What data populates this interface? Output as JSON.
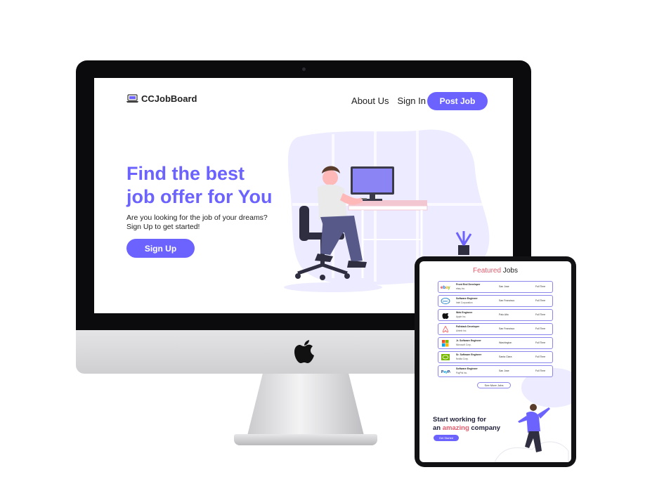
{
  "colors": {
    "accent": "#6c63ff",
    "accent_pink": "#e25a6b",
    "text": "#1e1e1e",
    "bezel": "#0b0b0d",
    "blob": "#ecebff"
  },
  "desktop": {
    "nav": {
      "logo_text": "CCJobBoard",
      "logo_icon": "laptop-icon",
      "links": [
        "About Us",
        "Sign In"
      ],
      "post_job_label": "Post Job"
    },
    "hero": {
      "title_line1": "Find the best",
      "title_line2": "job offer for You",
      "subtitle_line1": "Are you looking for the job of your dreams?",
      "subtitle_line2": "Sign Up to get started!",
      "signup_label": "Sign Up"
    }
  },
  "tablet": {
    "featured_title_accent": "Featured",
    "featured_title_rest": " Jobs",
    "jobs": [
      {
        "title": "Front End Developer",
        "company": "ebay Inc.",
        "location": "San Jose",
        "type": "Full Time",
        "logo": "ebay-logo"
      },
      {
        "title": "Software Engineer",
        "company": "Intel Corporation",
        "location": "San Francisco",
        "type": "Full Time",
        "logo": "intel-logo"
      },
      {
        "title": "Web Engineer",
        "company": "Apple Inc.",
        "location": "Palo Alto",
        "type": "Full Time",
        "logo": "apple-logo"
      },
      {
        "title": "Fullstack Developer",
        "company": "Airbnb Inc.",
        "location": "San Francisco",
        "type": "Full Time",
        "logo": "airbnb-logo"
      },
      {
        "title": "Jr. Software Engineer",
        "company": "Microsoft Corp.",
        "location": "Washington",
        "type": "Full Time",
        "logo": "microsoft-logo"
      },
      {
        "title": "Sr. Software Engineer",
        "company": "Nvidia Corp.",
        "location": "Santa Clara",
        "type": "Full Time",
        "logo": "nvidia-logo"
      },
      {
        "title": "Software Engineer",
        "company": "PayPal Inc.",
        "location": "San Jose",
        "type": "Full Time",
        "logo": "paypal-logo"
      }
    ],
    "see_more_label": "See More Jobs",
    "cta_line1": "Start working for",
    "cta_line2_pre": "an ",
    "cta_line2_accent": "amazing",
    "cta_line2_post": " company",
    "get_started_label": "Get Started"
  }
}
